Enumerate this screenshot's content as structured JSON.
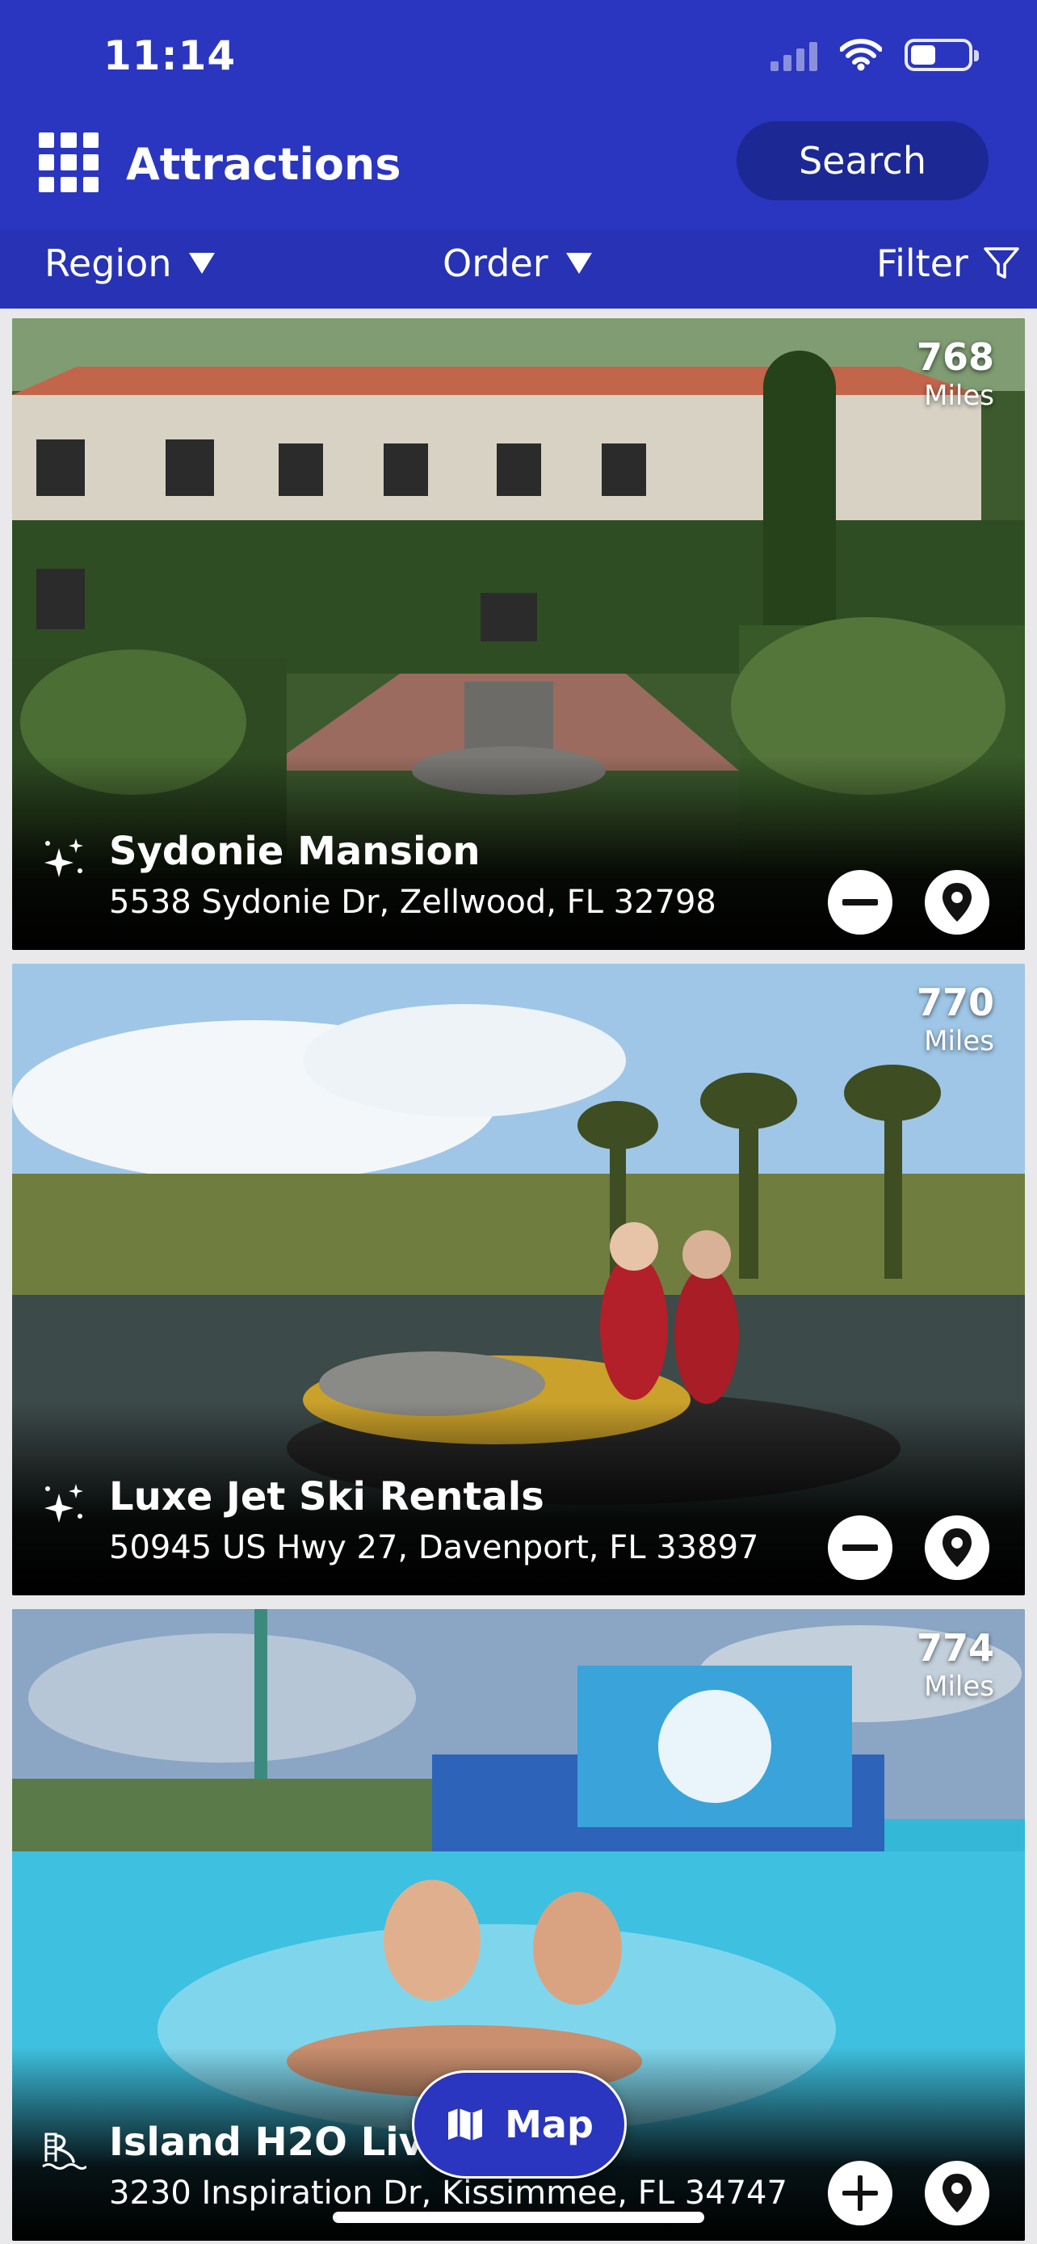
{
  "status_bar": {
    "time": "11:14"
  },
  "header": {
    "title": "Attractions",
    "search_label": "Search"
  },
  "filters": {
    "region_label": "Region",
    "order_label": "Order",
    "filter_label": "Filter"
  },
  "colors": {
    "brand_blue": "#2a35c0",
    "search_pill": "#1c2894",
    "filter_bar": "#2732b4"
  },
  "attractions": [
    {
      "name": "Sydonie Mansion",
      "address": "5538 Sydonie Dr, Zellwood, FL 32798",
      "distance": "768",
      "distance_unit": "Miles",
      "category_icon": "sparkles-icon",
      "action": "remove",
      "image": "mansion courtyard with fountain"
    },
    {
      "name": "Luxe Jet Ski Rentals",
      "address": "50945 US Hwy 27, Davenport, FL 33897",
      "distance": "770",
      "distance_unit": "Miles",
      "category_icon": "sparkles-icon",
      "action": "remove",
      "image": "two women on a jet ski on a lake"
    },
    {
      "name": "Island H2O Live!",
      "address": "3230 Inspiration Dr, Kissimmee, FL 34747",
      "distance": "774",
      "distance_unit": "Miles",
      "category_icon": "water-slide-icon",
      "action": "add",
      "image": "water park lazy river"
    }
  ],
  "map_button": {
    "label": "Map"
  }
}
